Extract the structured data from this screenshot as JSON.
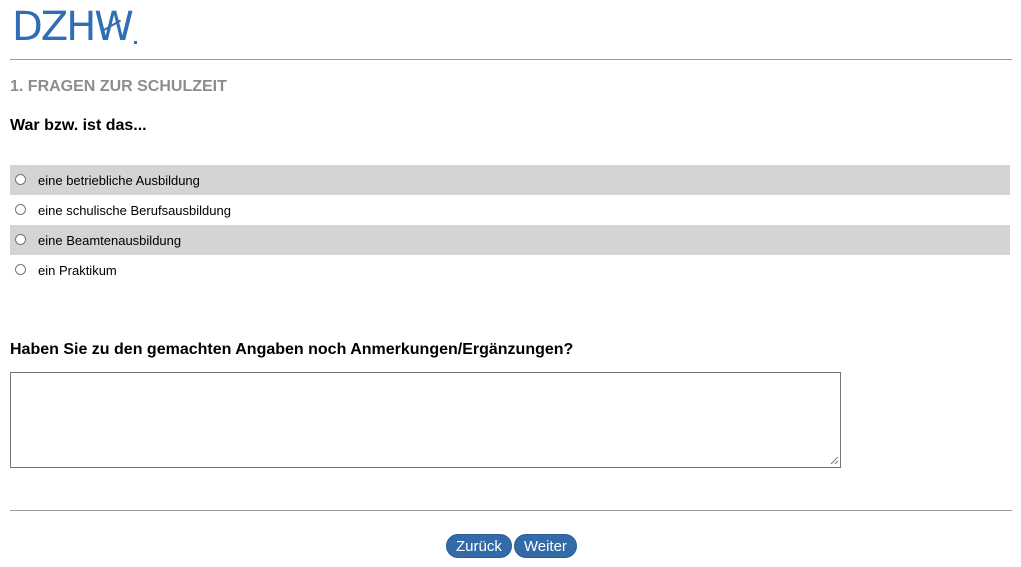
{
  "header": {
    "logo_text": "DZHW"
  },
  "section": {
    "title": "1. FRAGEN ZUR SCHULZEIT"
  },
  "question1": {
    "text": "War bzw. ist das...",
    "options": [
      {
        "label": "eine betriebliche Ausbildung"
      },
      {
        "label": "eine schulische Berufsausbildung"
      },
      {
        "label": "eine Beamtenausbildung"
      },
      {
        "label": "ein Praktikum"
      }
    ]
  },
  "question2": {
    "text": "Haben Sie zu den gemachten Angaben noch Anmerkungen/Ergänzungen?",
    "value": ""
  },
  "navigation": {
    "back_label": "Zurück",
    "next_label": "Weiter"
  },
  "colors": {
    "brand": "#2f6eb5",
    "button": "#336aa8",
    "row_shade": "#d4d4d4",
    "section_title": "#8d8d8d"
  }
}
